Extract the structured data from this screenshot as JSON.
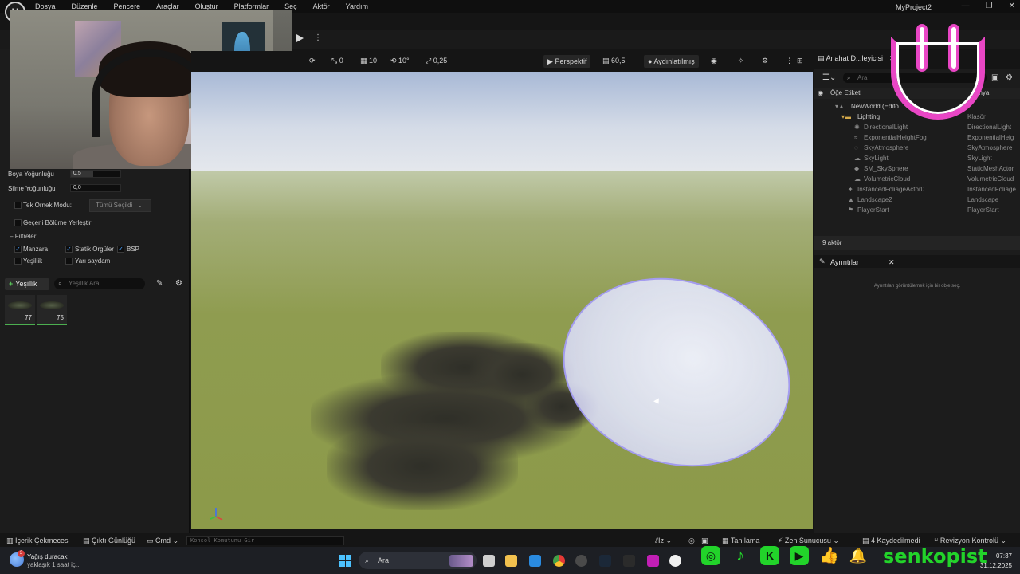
{
  "app": {
    "menu": [
      "Dosya",
      "Düzenle",
      "Pencere",
      "Araçlar",
      "Oluştur",
      "Platformlar",
      "Seç",
      "Aktör",
      "Yardım"
    ],
    "project": "MyProject2"
  },
  "left_panel": {
    "paint_density_label": "Boya Yoğunluğu",
    "paint_density_value": "0,5",
    "paint_density_fraction": 0.45,
    "erase_density_label": "Silme Yoğunluğu",
    "erase_density_value": "0,0",
    "single_instance_label": "Tek Örnek Modu:",
    "single_instance_dropdown": "Tümü Seçildi",
    "place_in_partition_label": "Geçerli Bölüme Yerleştir",
    "filters_label": "Filtreler",
    "filters": [
      {
        "label": "Manzara",
        "checked": true
      },
      {
        "label": "Statik Örgüler",
        "checked": true
      },
      {
        "label": "BSP",
        "checked": true
      },
      {
        "label": "Yeşillik",
        "checked": false
      },
      {
        "label": "Yarı saydam",
        "checked": false
      }
    ],
    "add_foliage_label": "Yeşillik",
    "search_placeholder": "Yeşillik Ara",
    "foliage_items": [
      {
        "count": "77"
      },
      {
        "count": "75"
      }
    ]
  },
  "viewport": {
    "toolbar": {
      "rotate_snap": "0",
      "grid_snap": "10",
      "angle_snap": "10°",
      "scale_snap": "0,25",
      "view_mode": "Perspektif",
      "fov": "60,5",
      "lighting": "Aydınlatılmış"
    }
  },
  "outliner": {
    "tab_label": "Anahat D...leyicisi",
    "search_placeholder": "Ara",
    "column_label": "Öğe Etiketi",
    "column_type_partial": "ünya",
    "rows": [
      {
        "name": "NewWorld (Edito",
        "type": ""
      },
      {
        "name": "Lighting",
        "type": "Klasör"
      },
      {
        "name": "DirectionalLight",
        "type": "DirectionalLight"
      },
      {
        "name": "ExponentialHeightFog",
        "type": "ExponentialHeig"
      },
      {
        "name": "SkyAtmosphere",
        "type": "SkyAtmosphere"
      },
      {
        "name": "SkyLight",
        "type": "SkyLight"
      },
      {
        "name": "SM_SkySphere",
        "type": "StaticMeshActor"
      },
      {
        "name": "VolumetricCloud",
        "type": "VolumetricCloud"
      },
      {
        "name": "InstancedFoliageActor0",
        "type": "InstancedFoliage"
      },
      {
        "name": "Landscape2",
        "type": "Landscape"
      },
      {
        "name": "PlayerStart",
        "type": "PlayerStart"
      }
    ],
    "actor_count": "9 aktör"
  },
  "details": {
    "tab_label": "Ayrıntılar",
    "hint": "Ayrıntıları görüntülemek için bir obje seç."
  },
  "statusbar": {
    "content_drawer": "İçerik Çekmecesi",
    "output_log": "Çıktı Günlüğü",
    "cmd": "Cmd",
    "console_placeholder": "Konsol Komutunu Gir",
    "trace": "İz",
    "diagnose": "Tanılama",
    "zen": "Zen Sunucusu",
    "saved": "4 Kaydedilmedi",
    "revision": "Revizyon Kontrolü"
  },
  "taskbar": {
    "weather_line1": "Yağış duracak",
    "weather_line2": "yaklaşık 1 saat iç...",
    "weather_badge": "3",
    "search_label": "Ara",
    "time": "07:37",
    "date": "31.12.2025"
  },
  "overlay": {
    "brand": "senkopist",
    "brand_color": "#22d32a",
    "smiley_color": "#e946c5"
  }
}
